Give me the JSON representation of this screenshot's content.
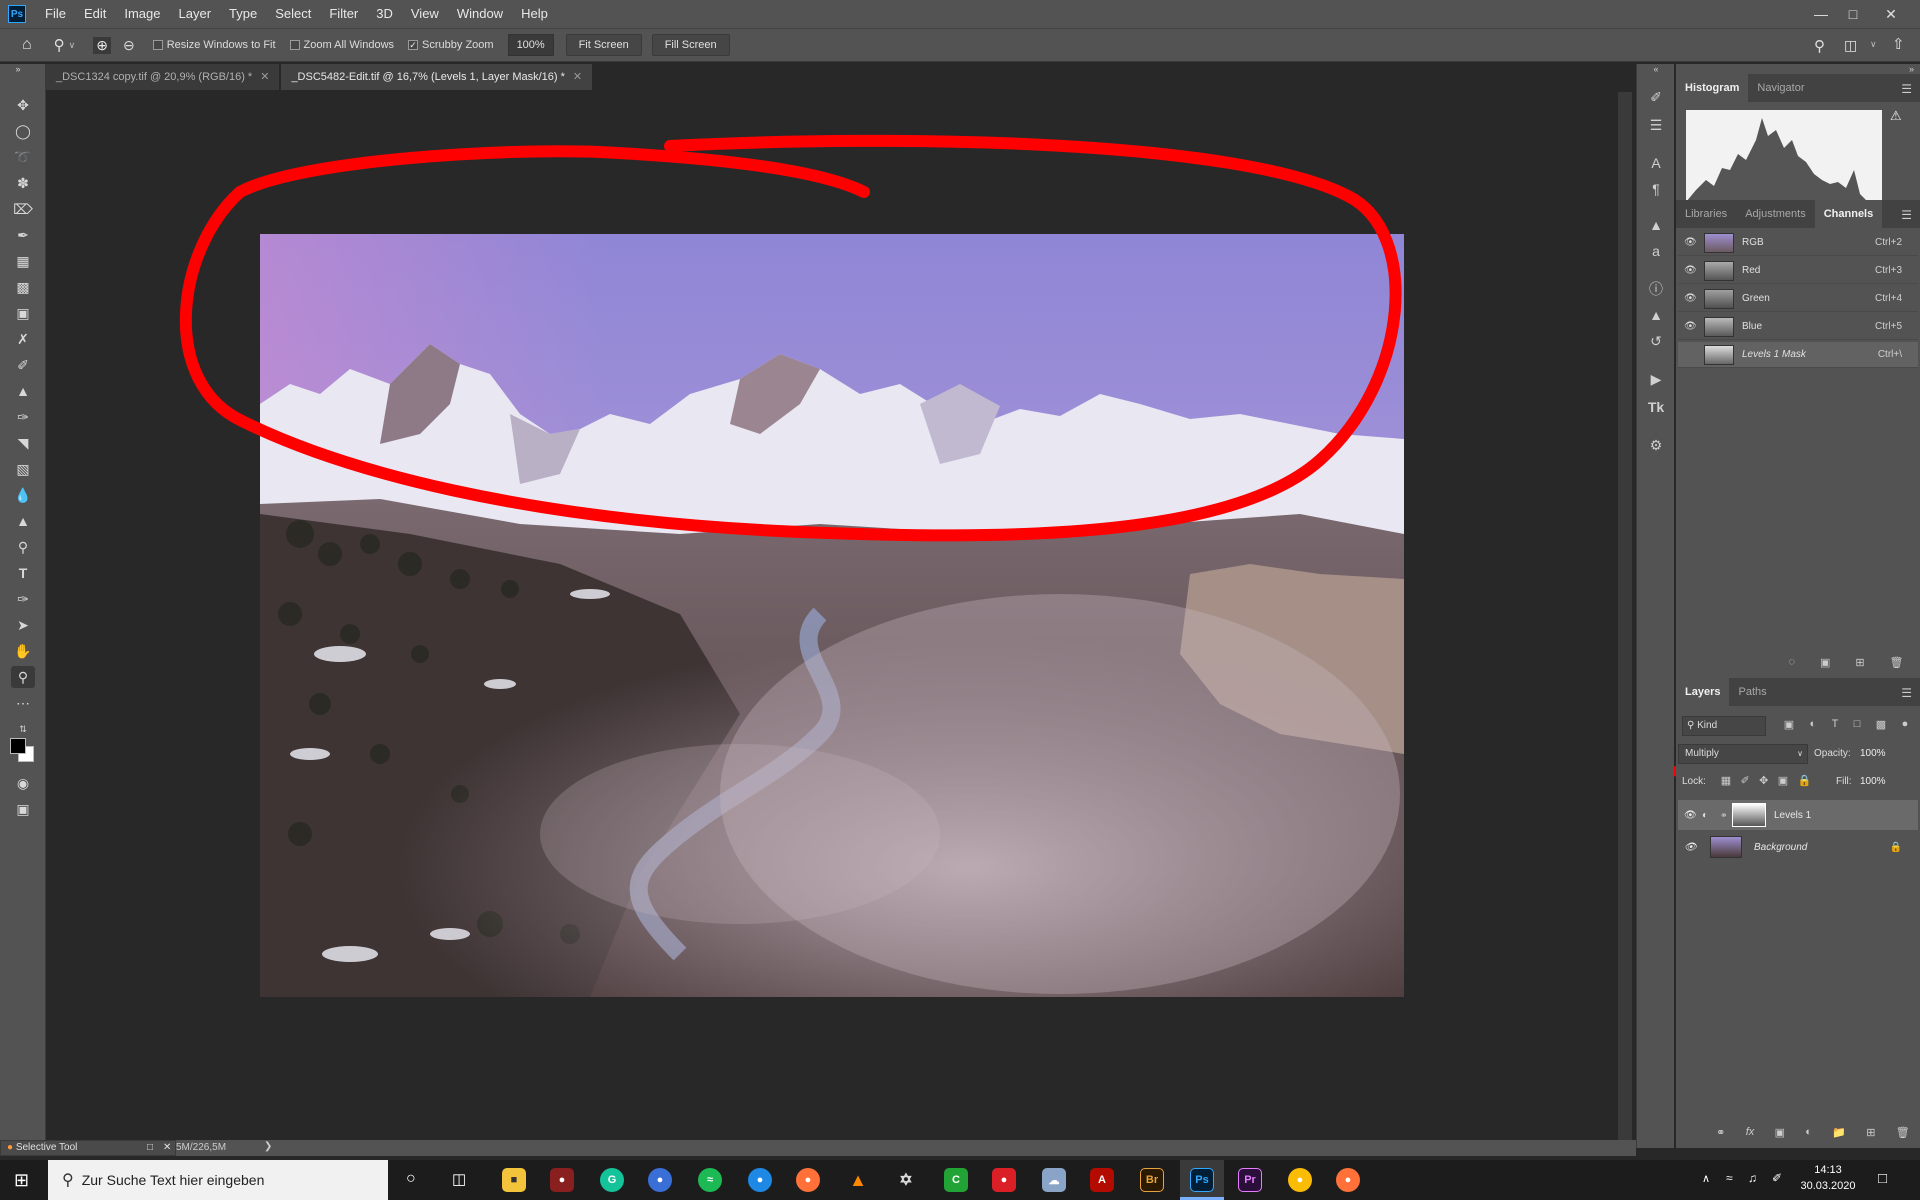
{
  "app": {
    "logo_text": "Ps",
    "menus": [
      "File",
      "Edit",
      "Image",
      "Layer",
      "Type",
      "Select",
      "Filter",
      "3D",
      "View",
      "Window",
      "Help"
    ]
  },
  "options_bar": {
    "resize_windows": {
      "label": "Resize Windows to Fit",
      "checked": false
    },
    "zoom_all": {
      "label": "Zoom All Windows",
      "checked": false
    },
    "scrubby_zoom": {
      "label": "Scrubby Zoom",
      "checked": true
    },
    "zoom_value": "100%",
    "fit_screen": "Fit Screen",
    "fill_screen": "Fill Screen"
  },
  "tabs": [
    {
      "label": "_DSC1324 copy.tif @ 20,9% (RGB/16) *",
      "active": false
    },
    {
      "label": "_DSC5482-Edit.tif @ 16,7% (Levels 1, Layer Mask/16) *",
      "active": true
    }
  ],
  "histogram_panel": {
    "tabs": [
      "Histogram",
      "Navigator"
    ]
  },
  "channels_panel": {
    "tabs": [
      "Libraries",
      "Adjustments",
      "Channels"
    ],
    "channels": [
      {
        "name": "RGB",
        "shortcut": "Ctrl+2"
      },
      {
        "name": "Red",
        "shortcut": "Ctrl+3"
      },
      {
        "name": "Green",
        "shortcut": "Ctrl+4"
      },
      {
        "name": "Blue",
        "shortcut": "Ctrl+5"
      },
      {
        "name": "Levels 1 Mask",
        "shortcut": "Ctrl+\\"
      }
    ]
  },
  "layers_panel": {
    "tabs": [
      "Layers",
      "Paths"
    ],
    "kind_label": "Kind",
    "blend_mode": "Multiply",
    "opacity_label": "Opacity:",
    "opacity_value": "100%",
    "lock_label": "Lock:",
    "fill_label": "Fill:",
    "fill_value": "100%",
    "layers": [
      {
        "name": "Levels 1"
      },
      {
        "name": "Background"
      }
    ]
  },
  "status": {
    "tool_popup": "Selective Tool",
    "doc_size": "5M/226,5M"
  },
  "taskbar": {
    "search_placeholder": "Zur Suche Text hier eingeben",
    "time": "14:13",
    "date": "30.03.2020"
  },
  "colors": {
    "annotation_red": "#ff0000",
    "ui_panel": "#535353",
    "canvas_bg": "#282828"
  }
}
